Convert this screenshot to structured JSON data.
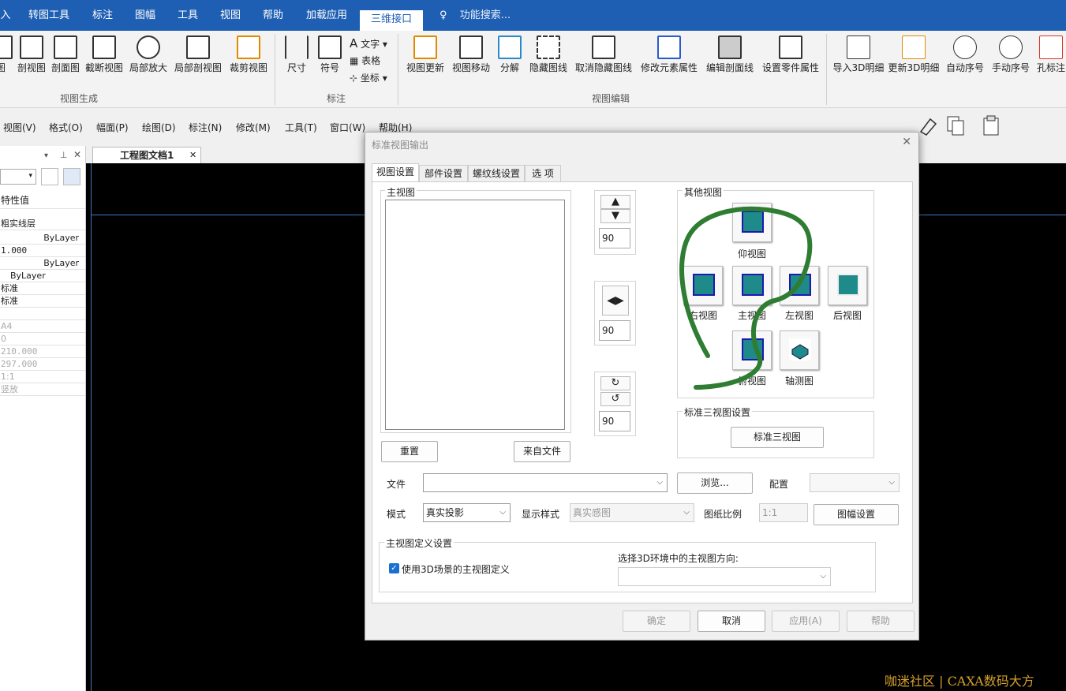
{
  "menubar": {
    "tabs": [
      {
        "label": "入"
      },
      {
        "label": "转图工具"
      },
      {
        "label": "标注"
      },
      {
        "label": "图幅"
      },
      {
        "label": "工具"
      },
      {
        "label": "视图"
      },
      {
        "label": "帮助"
      },
      {
        "label": "加载应用"
      },
      {
        "label": "三维接口"
      }
    ],
    "search": "功能搜索..."
  },
  "ribbon": {
    "view_gen": [
      "图",
      "剖视图",
      "剖面图",
      "截断视图",
      "局部放大",
      "局部剖视图",
      "裁剪视图"
    ],
    "view_gen_label": "视图生成",
    "annot": {
      "size": "尺寸",
      "symbol": "符号",
      "text": "文字",
      "table": "表格",
      "coord": "坐标",
      "group": "标注"
    },
    "view_edit": [
      "视图更新",
      "视图移动",
      "分解",
      "隐藏图线",
      "取消隐藏图线",
      "修改元素属性",
      "编辑剖面线",
      "设置零件属性"
    ],
    "view_edit_label": "视图编辑",
    "bom": [
      "导入3D明细",
      "更新3D明细",
      "自动序号",
      "手动序号",
      "孔标注"
    ]
  },
  "menu2": [
    "视图(V)",
    "格式(O)",
    "幅面(P)",
    "绘图(D)",
    "标注(N)",
    "修改(M)",
    "工具(T)",
    "窗口(W)",
    "帮助(H)"
  ],
  "panel": {
    "header": "特性值",
    "rows": [
      "粗实线层",
      "ByLayer",
      "1.000",
      "ByLayer",
      "ByLayer",
      "标准",
      "标准",
      "",
      "A4",
      "0",
      "210.000",
      "297.000",
      "1:1",
      "竖放"
    ]
  },
  "doc_tab": "工程图文档1",
  "watermark": "咖迷社区 | CAXA数码大方",
  "dialog": {
    "title": "标准视图输出",
    "tabs": [
      "视图设置",
      "部件设置",
      "螺纹线设置",
      "选 项"
    ],
    "main_view_label": "主视图",
    "other_views_label": "其他视图",
    "rot_values": [
      "90",
      "90",
      "90"
    ],
    "views": {
      "bottom": "仰视图",
      "right": "右视图",
      "front": "主视图",
      "left": "左视图",
      "back": "后视图",
      "top": "俯视图",
      "iso": "轴测图"
    },
    "std3_group": "标准三视图设置",
    "std3_button": "标准三视图",
    "reset": "重置",
    "from_file": "来自文件",
    "file_label": "文件",
    "browse": "浏览...",
    "config_label": "配置",
    "mode_label": "模式",
    "mode_value": "真实投影",
    "style_label": "显示样式",
    "style_value": "真实感图",
    "scale_label": "图纸比例",
    "scale_value": "1:1",
    "sheet_btn": "图幅设置",
    "def_group": "主视图定义设置",
    "use3d": "使用3D场景的主视图定义",
    "choose_dir": "选择3D环境中的主视图方向:",
    "ok": "确定",
    "cancel": "取消",
    "apply": "应用(A)",
    "help": "帮助"
  },
  "colors": {
    "menubar": "#1f5fb3",
    "annotation": "#2e7d32"
  }
}
